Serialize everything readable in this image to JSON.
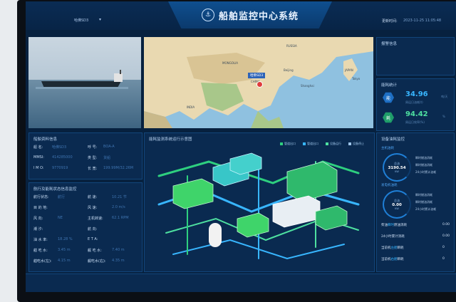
{
  "header": {
    "title": "船舶监控中心系统",
    "ship_selector": "哈佛SD3",
    "time_label": "更新时间:",
    "time_value": "2023-11-25 11:05:48"
  },
  "map_labels": [
    "RUSSIA",
    "MONGOLIA",
    "CHINA",
    "JAPAN",
    "INDIA",
    "Beijing",
    "Shanghai",
    "Tokyo"
  ],
  "map_tag": "哈佛SD3",
  "alarm": {
    "title": "报警信息"
  },
  "energy": {
    "title": "能耗统计",
    "items": [
      {
        "icon": "能",
        "value": "34.96",
        "sub": "周运日油耗(t)",
        "extra": "吨/天",
        "color": "#38b6ff",
        "hex": "#1e6fc4"
      },
      {
        "icon": "耗",
        "value": "94.42",
        "sub": "周运日效率(%)",
        "extra": "%",
        "color": "#4ee0a0",
        "hex": "#1f9e6a"
      }
    ]
  },
  "ship_info": {
    "title": "船舶资料信息",
    "rows": [
      {
        "k1": "船  名:",
        "v1": "哈佛SD3",
        "k2": "呼  号:",
        "v2": "BOA-A"
      },
      {
        "k1": "MMSI:",
        "v1": "414285000",
        "k2": "类  型:",
        "v2": "货船"
      },
      {
        "k1": "I M O:",
        "v1": "9770919",
        "k2": "长  宽:",
        "v2": "199.99M/32.26M"
      }
    ]
  },
  "run_info": {
    "title": "航行及能耗状态信息监控",
    "rows": [
      {
        "k1": "航行状态:",
        "v1": "航行",
        "k2": "航    速:",
        "v2": "10.21 节"
      },
      {
        "k1": "目 的 地:",
        "v1": "",
        "k2": "风    速:",
        "v2": "2.0 m/s"
      },
      {
        "k1": "风    向:",
        "v1": "NE",
        "k2": "主机转速:",
        "v2": "62.1 RPM"
      },
      {
        "k1": "潮    汐:",
        "v1": "",
        "k2": "航    向:",
        "v2": ""
      },
      {
        "k1": "油 水 率:",
        "v1": "18.28 %",
        "k2": "E T A:",
        "v2": ""
      },
      {
        "k1": "艏 吃 水:",
        "v1": "3.45 m",
        "k2": "艉 吃 水:",
        "v2": "7.40 m"
      },
      {
        "k1": "艏吃水(左):",
        "v1": "4.15 m",
        "k2": "艉吃水(右):",
        "v2": "4.35 m"
      }
    ]
  },
  "diagram": {
    "title": "能耗监测系统运行示意图",
    "legend": [
      {
        "label": "管道出口",
        "color": "#2ecf7f"
      },
      {
        "label": "管道出口",
        "color": "#38b6ff"
      },
      {
        "label": "设备运行",
        "color": "#4ee0a0"
      },
      {
        "label": "设备停止",
        "color": "#9cc3e8"
      }
    ]
  },
  "fuel": {
    "title": "设备油耗监控",
    "main": {
      "label": "主机油耗",
      "gauge_label": "总油",
      "gauge_value": "3190.54",
      "gauge_unit": "KW",
      "lines": [
        "瞬时燃油消耗",
        "瞬时燃油消耗",
        "24小时累计油耗"
      ]
    },
    "aux": {
      "label": "发电机油耗",
      "gauge_label": "总油",
      "gauge_value": "0.00",
      "gauge_unit": "KW",
      "lines": [
        "瞬时燃油消耗",
        "瞬时燃油消耗",
        "24小时累计油耗"
      ]
    },
    "summary": [
      {
        "pre": "柴油",
        "hi": "瞬时",
        "post": "燃油消耗",
        "val": "0.00"
      },
      {
        "pre": "24小时",
        "hi": "",
        "post": "累计消耗",
        "val": "0.00"
      }
    ],
    "bottom": [
      {
        "pre": "当前机",
        "hi": "左舱",
        "post": "瞬耗",
        "val": "0"
      },
      {
        "pre": "当前机",
        "hi": "右舱",
        "post": "瞬耗",
        "val": "0"
      }
    ]
  }
}
